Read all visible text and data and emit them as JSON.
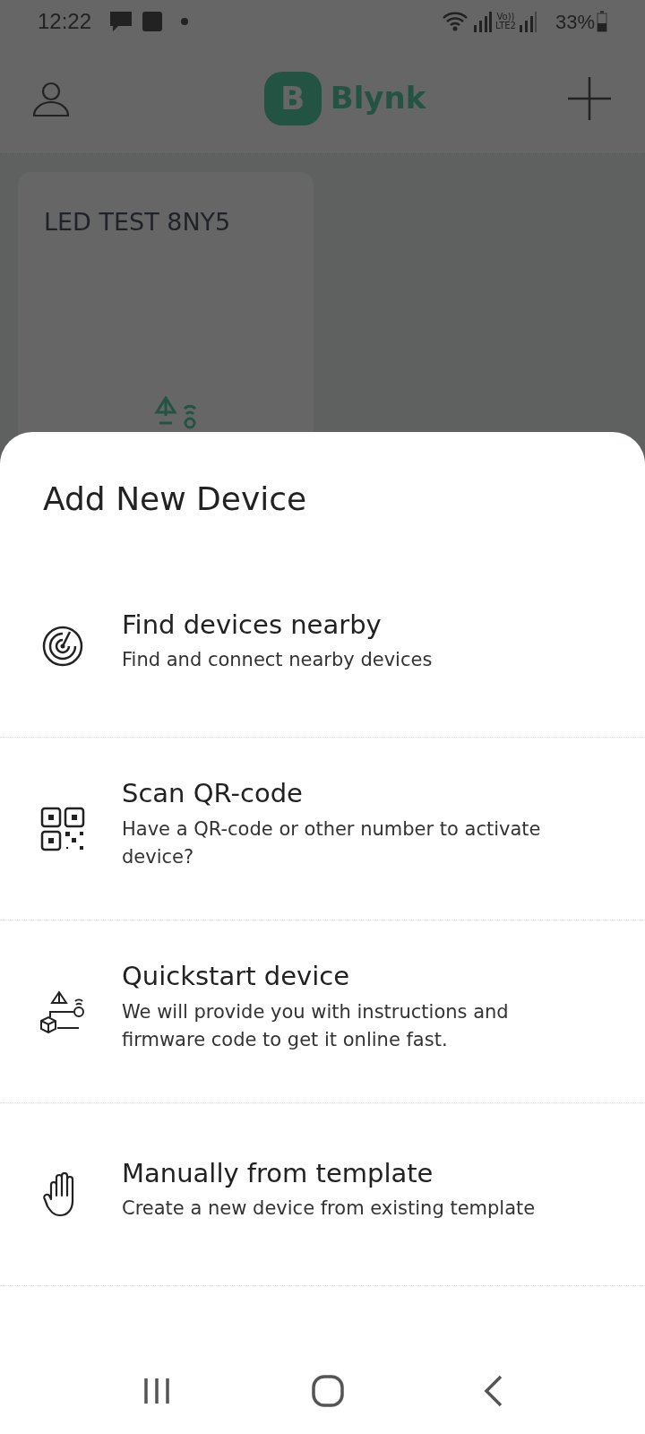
{
  "status_bar": {
    "time": "12:22",
    "volte_top": "Vo))",
    "volte_bottom": "LTE2",
    "battery": "33%"
  },
  "header": {
    "logo_letter": "B",
    "logo_text": "Blynk"
  },
  "devices": [
    {
      "name": "LED TEST 8NY5"
    }
  ],
  "sheet": {
    "title": "Add New Device",
    "options": [
      {
        "kind": "radar",
        "title": "Find devices nearby",
        "subtitle": "Find and connect nearby devices"
      },
      {
        "kind": "qr",
        "title": "Scan QR-code",
        "subtitle": "Have a QR-code or other number to activate device?"
      },
      {
        "kind": "quickstart",
        "title": "Quickstart device",
        "subtitle": "We will provide you with instructions and firmware code to get it online fast."
      },
      {
        "kind": "hand",
        "title": "Manually from template",
        "subtitle": "Create a new device from existing template"
      }
    ]
  }
}
